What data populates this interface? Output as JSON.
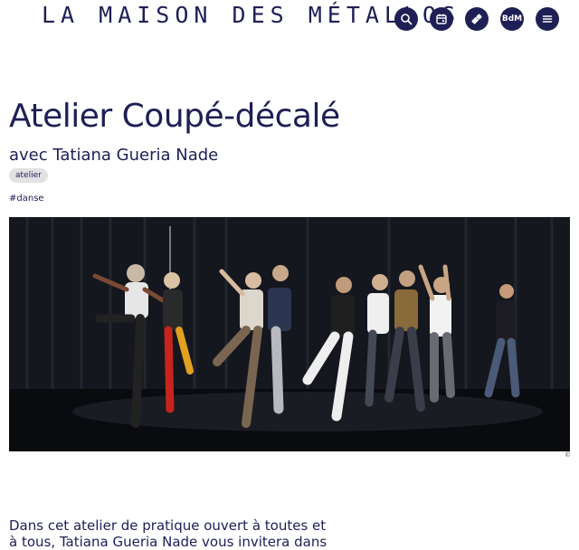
{
  "header": {
    "logo_text": "LA MAISON DES MÉTALLOS",
    "nav": [
      {
        "icon": "search-icon"
      },
      {
        "icon": "calendar-icon"
      },
      {
        "icon": "ticket-icon"
      },
      {
        "icon": "bdm-badge",
        "label": "BdM"
      },
      {
        "icon": "menu-icon"
      }
    ]
  },
  "event": {
    "title": "Atelier Coupé-décalé",
    "subtitle": "avec Tatiana Gueria Nade",
    "category_tag": "atelier",
    "hashtag": "#danse",
    "photo_credit": "©"
  },
  "body": {
    "intro": "Dans cet atelier de pratique ouvert à toutes et à tous, Tatiana Gueria Nade vous invitera dans"
  },
  "colors": {
    "primary": "#1e1f55",
    "tag_bg": "#e2e2e4",
    "background": "#ffffff"
  }
}
